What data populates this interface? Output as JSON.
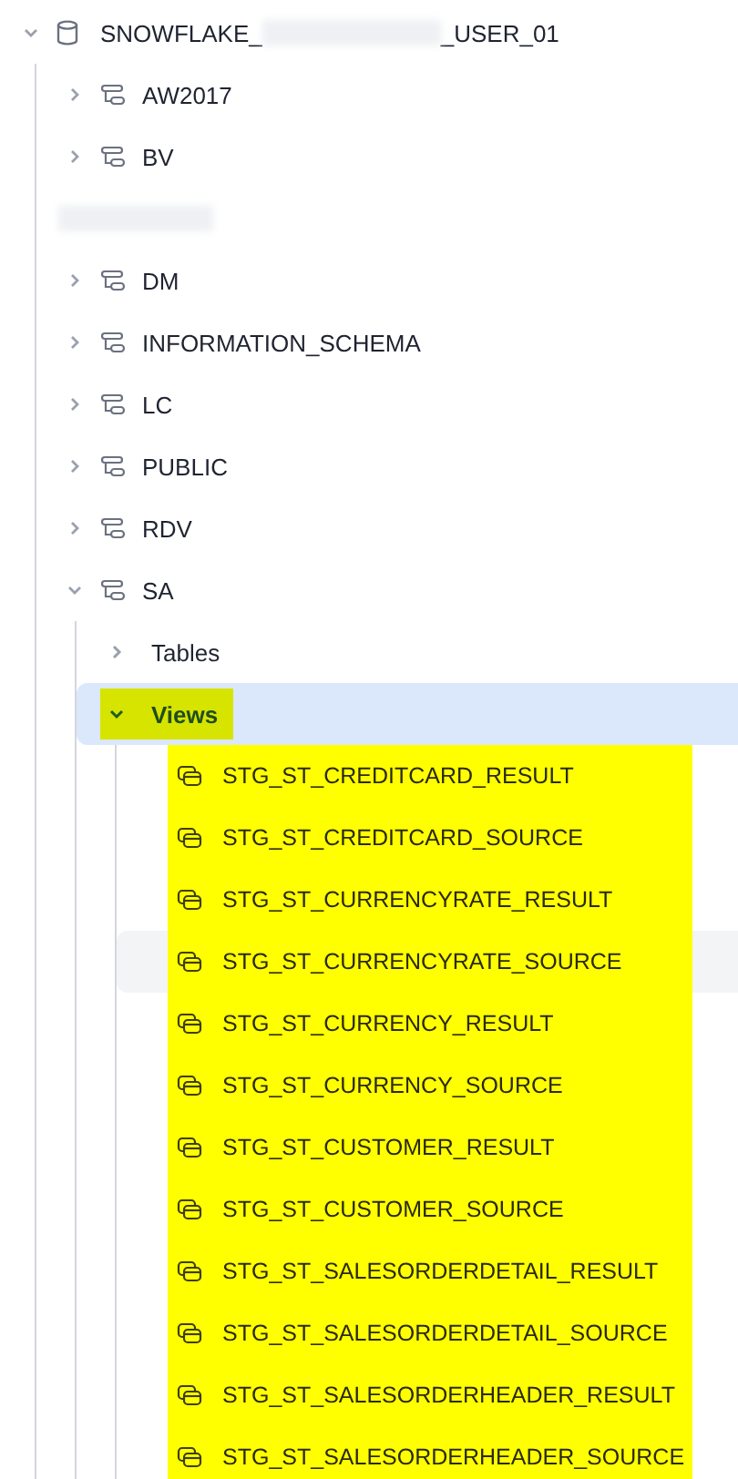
{
  "database": {
    "name_start": "SNOWFLAKE_",
    "name_end": "_USER_01",
    "expanded": true,
    "schemas": [
      {
        "kind": "schema",
        "name": "AW2017",
        "expanded": false
      },
      {
        "kind": "schema",
        "name": "BV",
        "expanded": false
      },
      {
        "kind": "redacted"
      },
      {
        "kind": "schema",
        "name": "DM",
        "expanded": false
      },
      {
        "kind": "schema",
        "name": "INFORMATION_SCHEMA",
        "expanded": false
      },
      {
        "kind": "schema",
        "name": "LC",
        "expanded": false
      },
      {
        "kind": "schema",
        "name": "PUBLIC",
        "expanded": false
      },
      {
        "kind": "schema",
        "name": "RDV",
        "expanded": false
      },
      {
        "kind": "schema",
        "name": "SA",
        "expanded": true,
        "children": [
          {
            "name": "Tables",
            "expanded": false,
            "selected": false,
            "highlighted": false
          },
          {
            "name": "Views",
            "expanded": true,
            "selected": true,
            "highlighted": true,
            "children": [
              {
                "name": "STG_ST_CREDITCARD_RESULT",
                "highlighted": true,
                "hovered": false
              },
              {
                "name": "STG_ST_CREDITCARD_SOURCE",
                "highlighted": true,
                "hovered": false
              },
              {
                "name": "STG_ST_CURRENCYRATE_RESULT",
                "highlighted": true,
                "hovered": false
              },
              {
                "name": "STG_ST_CURRENCYRATE_SOURCE",
                "highlighted": true,
                "hovered": true
              },
              {
                "name": "STG_ST_CURRENCY_RESULT",
                "highlighted": true,
                "hovered": false
              },
              {
                "name": "STG_ST_CURRENCY_SOURCE",
                "highlighted": true,
                "hovered": false
              },
              {
                "name": "STG_ST_CUSTOMER_RESULT",
                "highlighted": true,
                "hovered": false
              },
              {
                "name": "STG_ST_CUSTOMER_SOURCE",
                "highlighted": true,
                "hovered": false
              },
              {
                "name": "STG_ST_SALESORDERDETAIL_RESULT",
                "highlighted": true,
                "hovered": false
              },
              {
                "name": "STG_ST_SALESORDERDETAIL_SOURCE",
                "highlighted": true,
                "hovered": false
              },
              {
                "name": "STG_ST_SALESORDERHEADER_RESULT",
                "highlighted": true,
                "hovered": false
              },
              {
                "name": "STG_ST_SALESORDERHEADER_SOURCE",
                "highlighted": true,
                "hovered": false
              }
            ]
          }
        ]
      }
    ]
  }
}
